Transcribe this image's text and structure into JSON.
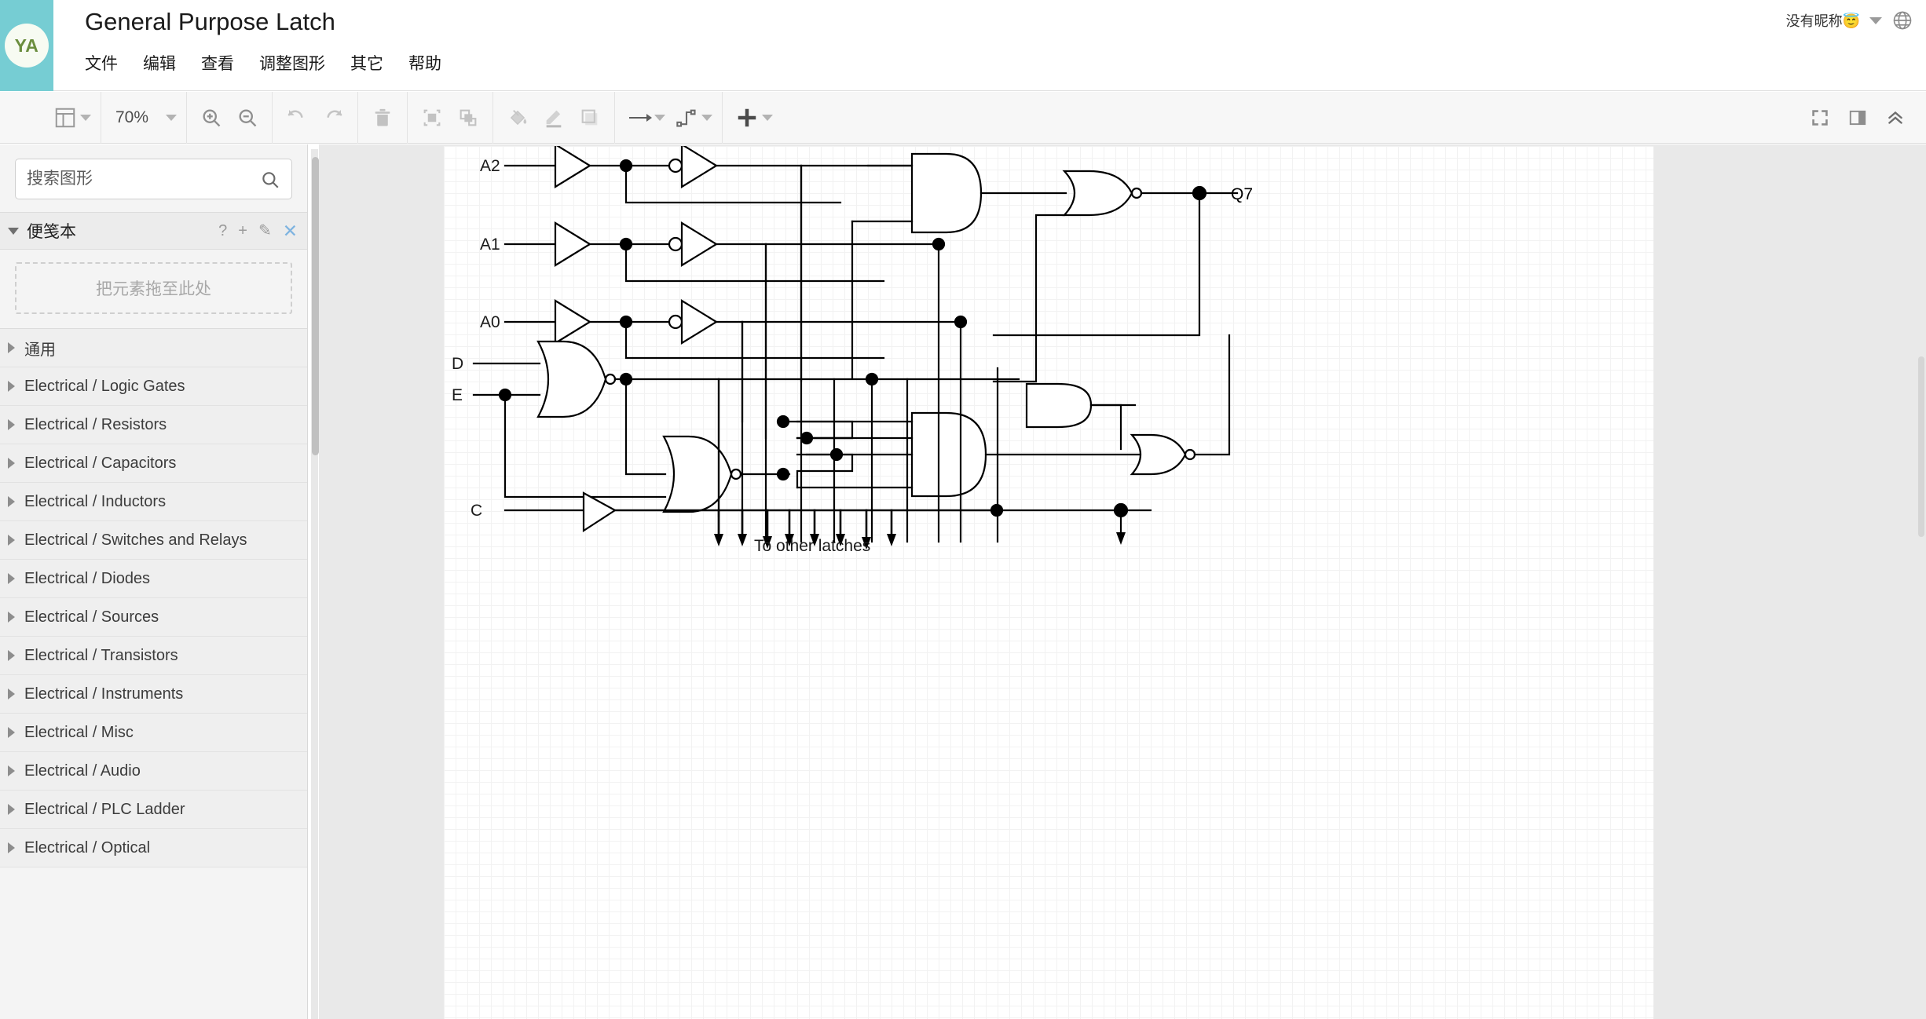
{
  "header": {
    "logo_text": "YA",
    "logo_bg": "#76cdd3",
    "title": "General Purpose Latch",
    "menu": [
      {
        "label": "文件"
      },
      {
        "label": "编辑"
      },
      {
        "label": "查看"
      },
      {
        "label": "调整图形"
      },
      {
        "label": "其它"
      },
      {
        "label": "帮助"
      }
    ],
    "user_name": "没有昵称😇",
    "user_caret_icon": "chevron-down-icon",
    "language_icon": "globe-icon"
  },
  "toolbar": {
    "view_layout_icon": "layout-panel-icon",
    "zoom_value": "70%",
    "zoom_in_icon": "zoom-in-icon",
    "zoom_out_icon": "zoom-out-icon",
    "undo_icon": "undo-icon",
    "redo_icon": "redo-icon",
    "delete_icon": "trash-icon",
    "to_front_icon": "bring-to-front-icon",
    "to_back_icon": "send-to-back-icon",
    "fill_color_icon": "fill-bucket-icon",
    "line_color_icon": "pencil-line-icon",
    "shadow_icon": "shadow-rect-icon",
    "arrow_style_icon": "arrow-line-icon",
    "waypoint_style_icon": "elbow-connector-icon",
    "insert_icon": "plus-icon",
    "fullscreen_icon": "fullscreen-icon",
    "format_panel_icon": "format-panel-icon",
    "collapse_icon": "chevron-up-double-icon"
  },
  "sidebar": {
    "search": {
      "placeholder": "搜索图形",
      "value": "",
      "icon": "search-icon"
    },
    "scratchpad": {
      "title": "便笺本",
      "help_icon": "?",
      "add_icon": "+",
      "edit_icon": "✎",
      "close_icon": "✕",
      "drop_hint": "把元素拖至此处"
    },
    "palette_items": [
      {
        "label": "通用"
      },
      {
        "label": "Electrical / Logic Gates"
      },
      {
        "label": "Electrical / Resistors"
      },
      {
        "label": "Electrical / Capacitors"
      },
      {
        "label": "Electrical / Inductors"
      },
      {
        "label": "Electrical / Switches and Relays"
      },
      {
        "label": "Electrical / Diodes"
      },
      {
        "label": "Electrical / Sources"
      },
      {
        "label": "Electrical / Transistors"
      },
      {
        "label": "Electrical / Instruments"
      },
      {
        "label": "Electrical / Misc"
      },
      {
        "label": "Electrical / Audio"
      },
      {
        "label": "Electrical / PLC Ladder"
      },
      {
        "label": "Electrical / Optical"
      }
    ]
  },
  "canvas": {
    "diagram_title": "General Purpose Latch",
    "labels": {
      "a2": "A2",
      "a1": "A1",
      "a0": "A0",
      "d": "D",
      "e": "E",
      "c": "C",
      "q7": "Q7",
      "other_latches": "To other latches"
    },
    "gate_count": 8,
    "input_signals": [
      "A2",
      "A1",
      "A0",
      "D",
      "E",
      "C"
    ],
    "output_signals": [
      "Q7"
    ],
    "stroke_color": "#000000",
    "fill_color": "#ffffff"
  }
}
